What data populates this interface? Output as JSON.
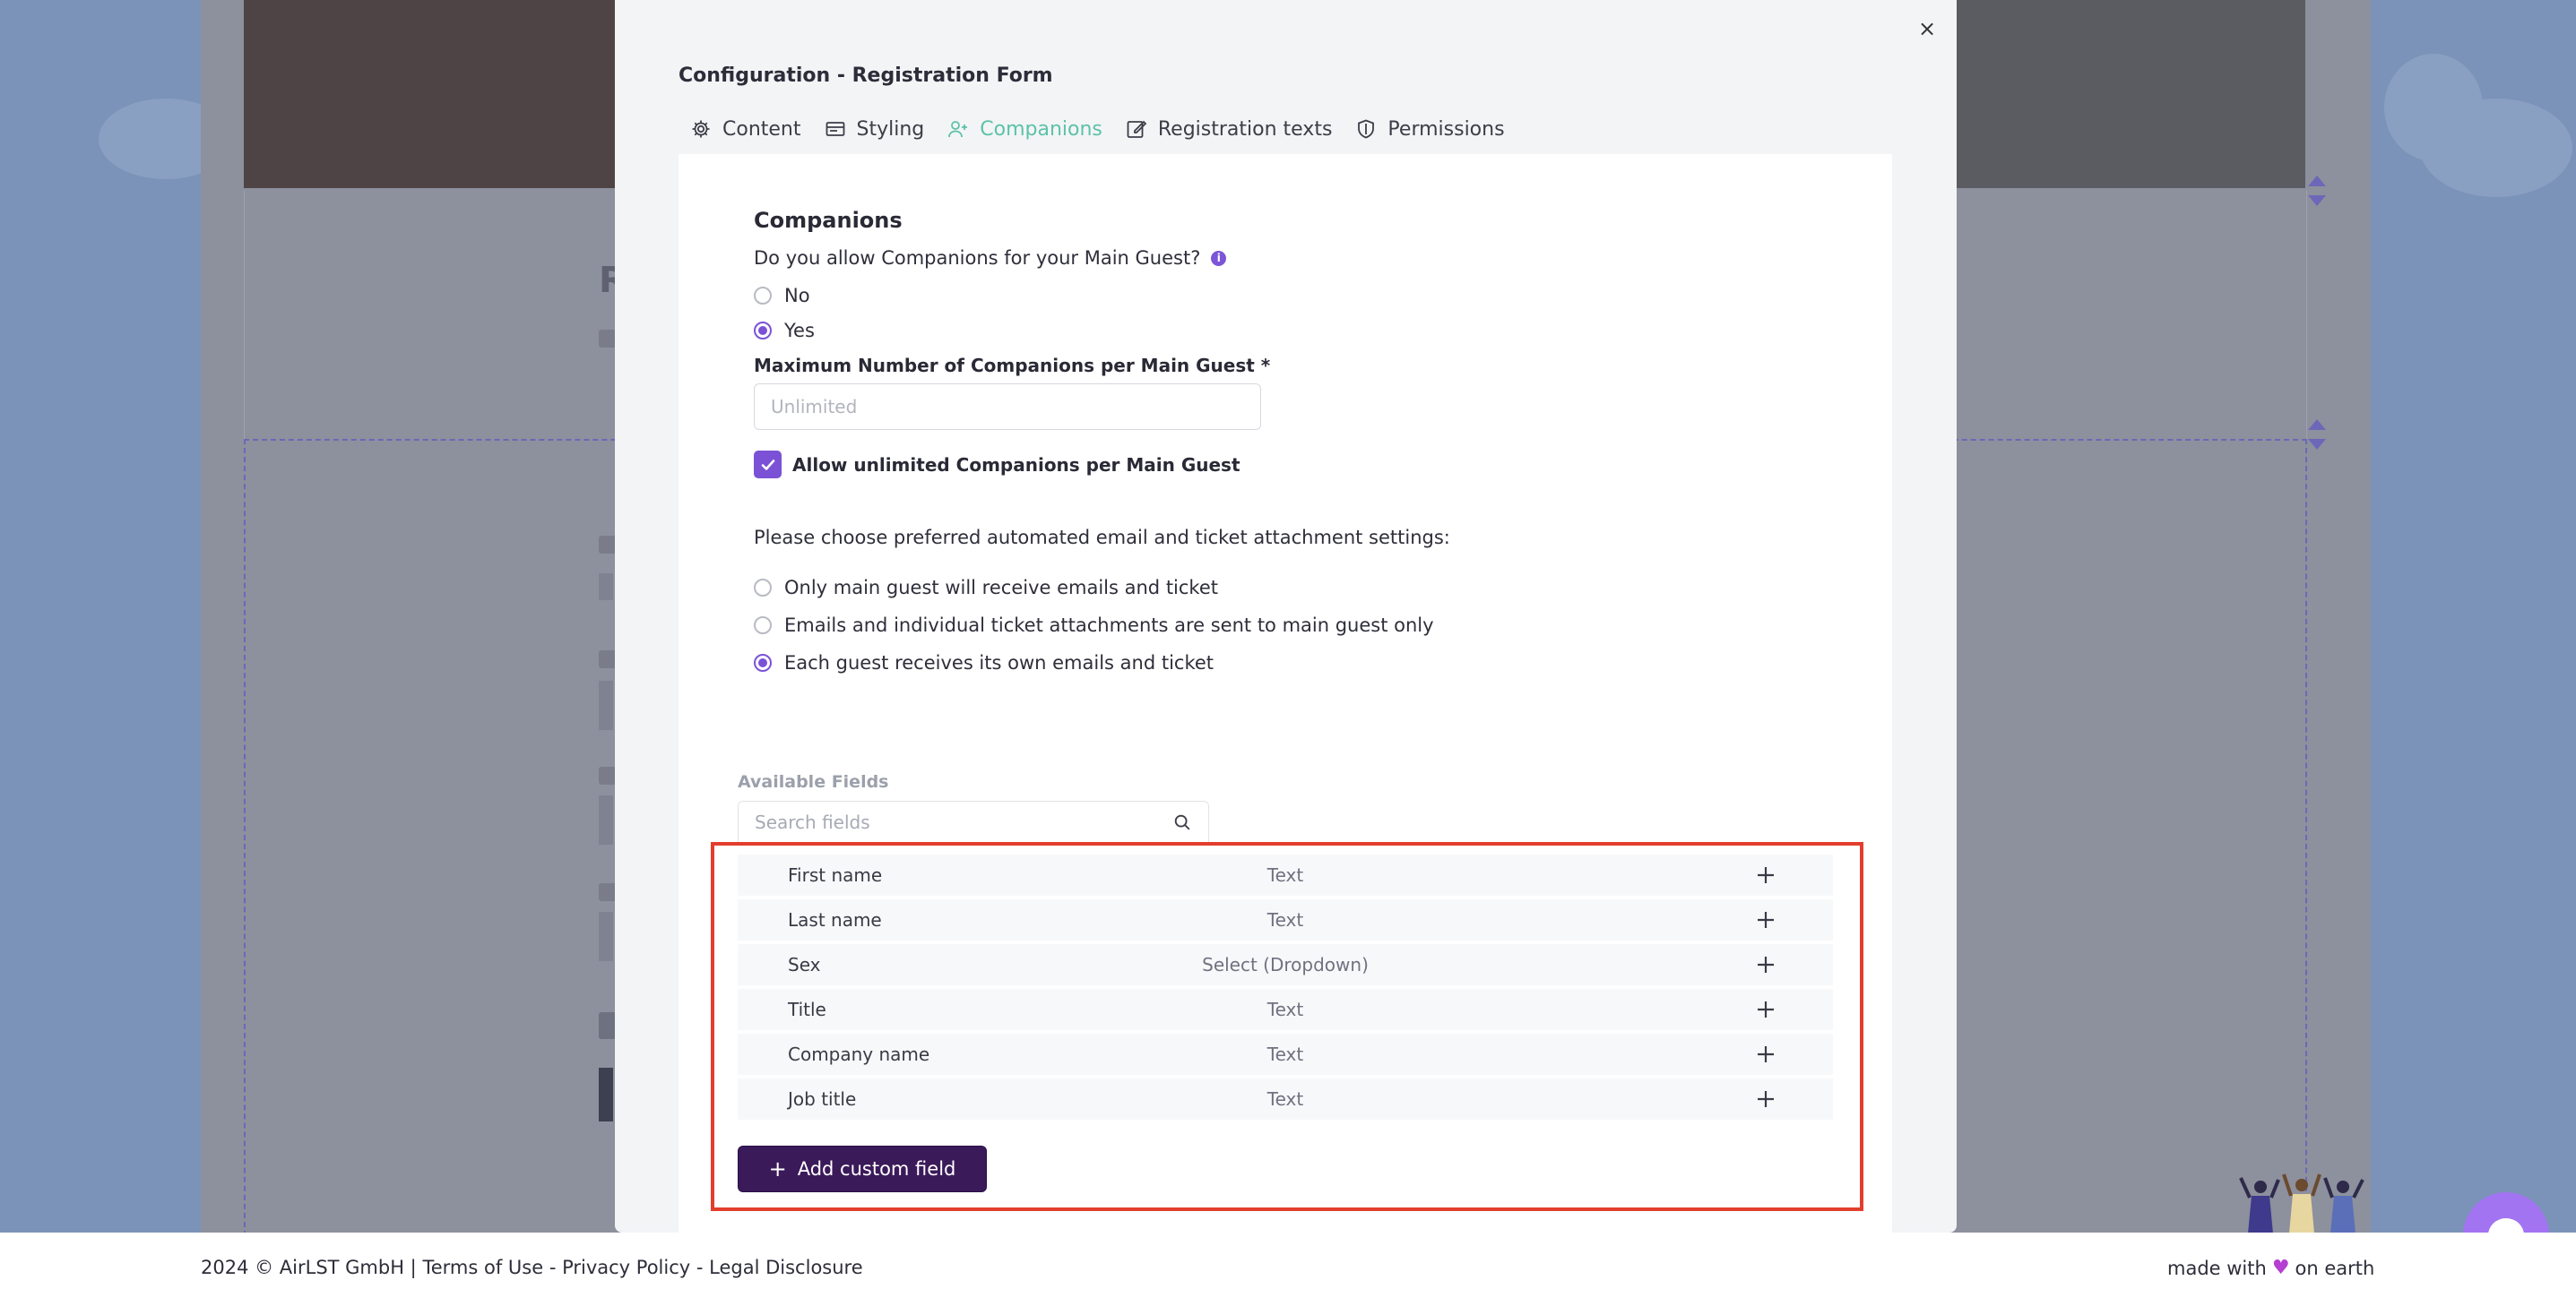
{
  "modal": {
    "title": "Configuration - Registration Form",
    "close_label": "×"
  },
  "tabs": [
    {
      "label": "Content",
      "icon": "gear-icon",
      "active": false
    },
    {
      "label": "Styling",
      "icon": "styling-icon",
      "active": false
    },
    {
      "label": "Companions",
      "icon": "add-user-icon",
      "active": true
    },
    {
      "label": "Registration texts",
      "icon": "edit-icon",
      "active": false
    },
    {
      "label": "Permissions",
      "icon": "shield-icon",
      "active": false
    }
  ],
  "companions": {
    "section_title": "Companions",
    "question": "Do you allow Companions for your Main Guest?",
    "options": [
      {
        "label": "No",
        "selected": false
      },
      {
        "label": "Yes",
        "selected": true
      }
    ],
    "max_label": "Maximum Number of Companions per Main Guest *",
    "max_placeholder": "Unlimited",
    "max_value": "",
    "unlimited_label": "Allow unlimited Companions per Main Guest",
    "unlimited_checked": true,
    "email_question": "Please choose preferred automated email and ticket attachment settings:",
    "email_options": [
      {
        "label": "Only main guest will receive emails and ticket",
        "selected": false
      },
      {
        "label": "Emails and individual ticket attachments are sent to main guest only",
        "selected": false
      },
      {
        "label": "Each guest receives its own emails and ticket",
        "selected": true
      }
    ]
  },
  "available_fields": {
    "label": "Available Fields",
    "search_placeholder": "Search fields",
    "rows": [
      {
        "name": "First name",
        "type": "Text"
      },
      {
        "name": "Last name",
        "type": "Text"
      },
      {
        "name": "Sex",
        "type": "Select (Dropdown)"
      },
      {
        "name": "Title",
        "type": "Text"
      },
      {
        "name": "Company name",
        "type": "Text"
      },
      {
        "name": "Job title",
        "type": "Text"
      }
    ],
    "add_button_label": "Add custom field"
  },
  "footer": {
    "copyright": "2024 © AirLST GmbH |",
    "terms": "Terms of Use",
    "privacy": "Privacy Policy",
    "legal": "Legal Disclosure",
    "separator": "-",
    "made_with": "made with",
    "on_earth": "on earth"
  },
  "colors": {
    "accent": "#7b52d6",
    "active_tab": "#5cc2a8",
    "primary_button": "#3b1a5a",
    "highlight_border": "#e33e2d",
    "chat": "#a274f2"
  }
}
